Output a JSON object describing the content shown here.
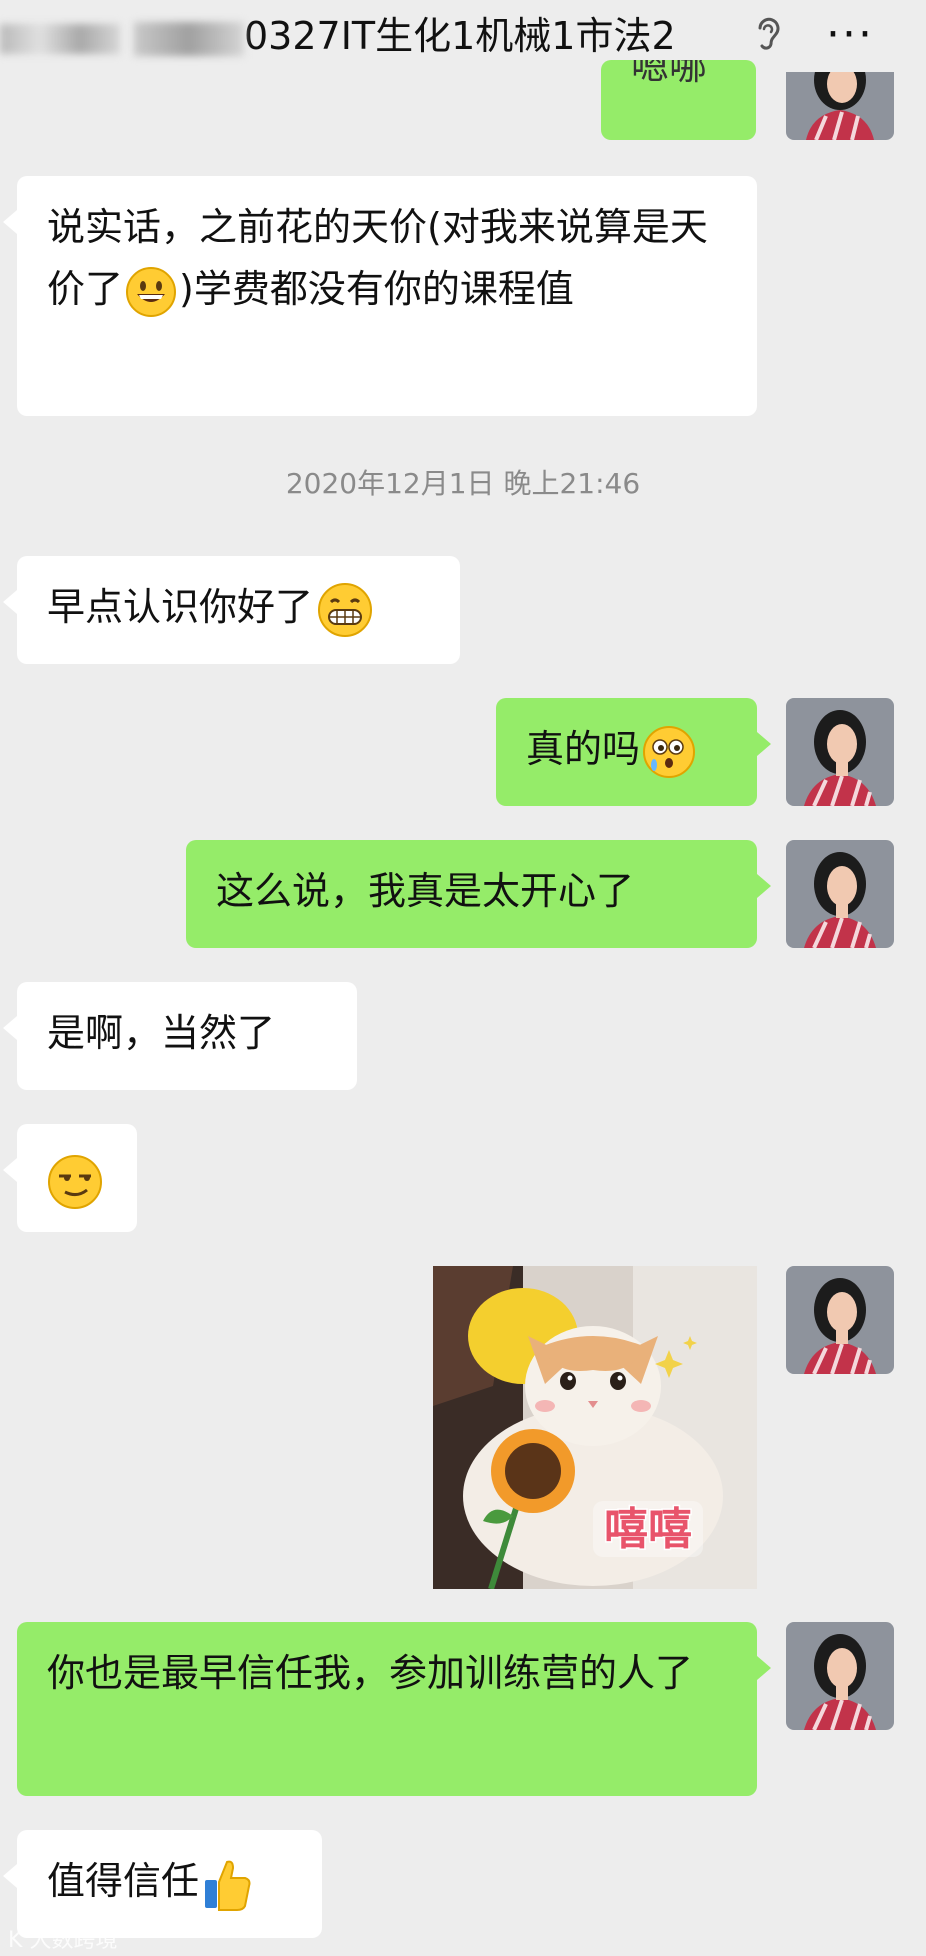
{
  "header": {
    "title_suffix": "0327IT生化1机械1市法2",
    "more_label": "···",
    "icons": {
      "ear": "ear-icon",
      "more": "more-icon"
    }
  },
  "messages": {
    "m0_partial": "嗯哪",
    "m1": "说实话，之前花的天价(对我来说算是天价了",
    "m1_tail": ")学费都没有你的课程值",
    "timestamp": "2020年12月1日 晚上21:46",
    "m2": "早点认识你好了",
    "m3": "真的吗",
    "m4": "这么说，我真是太开心了",
    "m5": "是啊，当然了",
    "m7_sticker_text": "嘻嘻",
    "m8": "你也是最早信任我，参加训练营的人了",
    "m9": "值得信任"
  },
  "watermark": "大数跨境",
  "colors": {
    "background": "#ededed",
    "incoming_bubble": "#ffffff",
    "outgoing_bubble": "#95ec69"
  }
}
